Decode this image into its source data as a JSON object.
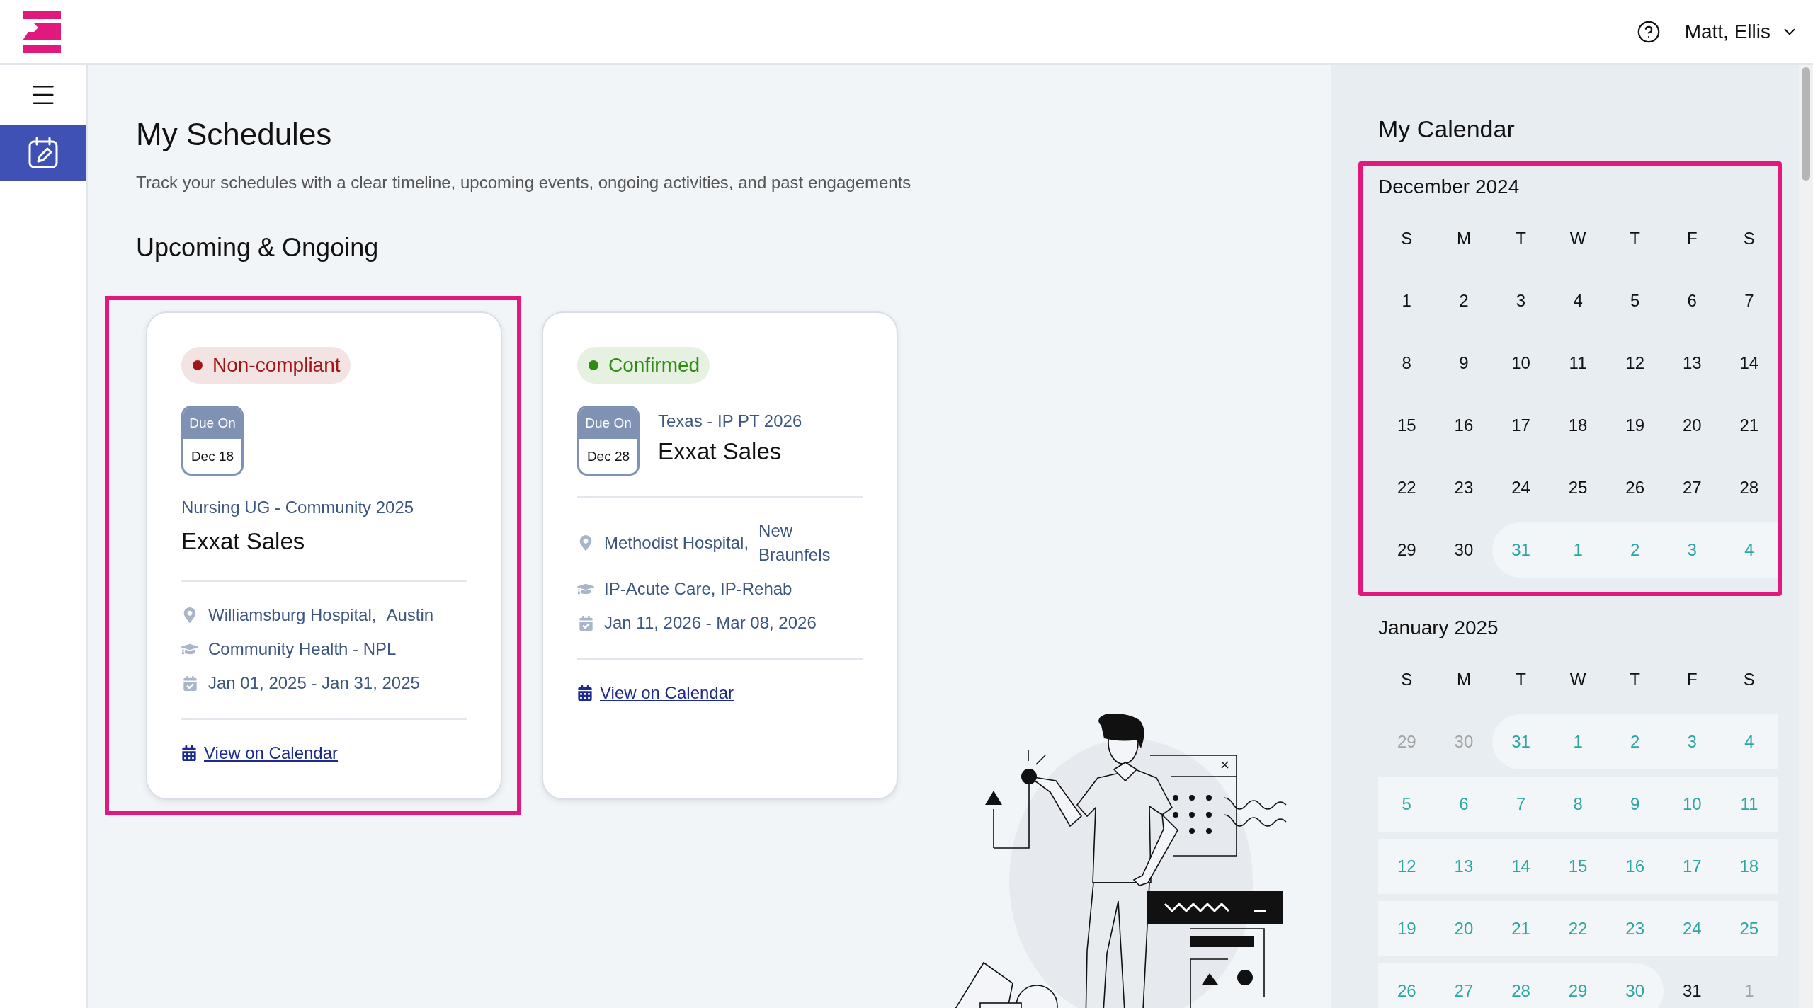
{
  "header": {
    "user_name": "Matt, Ellis"
  },
  "sidebar": {
    "items": [
      {
        "selected": true
      }
    ]
  },
  "page": {
    "title": "My Schedules",
    "subtitle": "Track your schedules with a clear timeline, upcoming events, ongoing activities, and past engagements",
    "section_title": "Upcoming & Ongoing"
  },
  "schedules": [
    {
      "kind": "stacked",
      "highlighted": true,
      "status": {
        "label": "Non-compliant",
        "color": "#a01515"
      },
      "due_label": "Due On",
      "due_date": "Dec 18",
      "program": "Nursing UG - Community 2025",
      "name": "Exxat Sales",
      "hospital": "Williamsburg Hospital,",
      "city": "Austin",
      "specialty": "Community Health - NPL",
      "dates": "Jan 01, 2025 - Jan 31, 2025",
      "link": "View on Calendar"
    },
    {
      "kind": "inline",
      "highlighted": false,
      "status": {
        "label": "Confirmed",
        "color": "#2e8b14"
      },
      "due_label": "Due On",
      "due_date": "Dec 28",
      "program": "Texas - IP PT 2026",
      "name": "Exxat Sales",
      "hospital": "Methodist Hospital,",
      "city": "New Braunfels",
      "specialty": "IP-Acute Care, IP-Rehab",
      "dates": "Jan 11, 2026 - Mar 08, 2026",
      "link": "View on Calendar"
    }
  ],
  "calendar": {
    "title": "My Calendar",
    "months": [
      {
        "title": "December 2024",
        "highlighted": true,
        "weekdays": [
          "S",
          "M",
          "T",
          "W",
          "T",
          "F",
          "S"
        ],
        "weeks": [
          [
            {
              "day": "1",
              "kind": "current"
            },
            {
              "day": "2",
              "kind": "current"
            },
            {
              "day": "3",
              "kind": "current"
            },
            {
              "day": "4",
              "kind": "current"
            },
            {
              "day": "5",
              "kind": "current"
            },
            {
              "day": "6",
              "kind": "current"
            },
            {
              "day": "7",
              "kind": "current"
            }
          ],
          [
            {
              "day": "8",
              "kind": "current"
            },
            {
              "day": "9",
              "kind": "current"
            },
            {
              "day": "10",
              "kind": "current"
            },
            {
              "day": "11",
              "kind": "current"
            },
            {
              "day": "12",
              "kind": "current"
            },
            {
              "day": "13",
              "kind": "current"
            },
            {
              "day": "14",
              "kind": "current"
            }
          ],
          [
            {
              "day": "15",
              "kind": "current"
            },
            {
              "day": "16",
              "kind": "current"
            },
            {
              "day": "17",
              "kind": "current"
            },
            {
              "day": "18",
              "kind": "current"
            },
            {
              "day": "19",
              "kind": "current"
            },
            {
              "day": "20",
              "kind": "current"
            },
            {
              "day": "21",
              "kind": "current"
            }
          ],
          [
            {
              "day": "22",
              "kind": "current"
            },
            {
              "day": "23",
              "kind": "current"
            },
            {
              "day": "24",
              "kind": "current"
            },
            {
              "day": "25",
              "kind": "current"
            },
            {
              "day": "26",
              "kind": "current"
            },
            {
              "day": "27",
              "kind": "current"
            },
            {
              "day": "28",
              "kind": "current"
            }
          ],
          [
            {
              "day": "29",
              "kind": "current"
            },
            {
              "day": "30",
              "kind": "current"
            },
            {
              "day": "31",
              "kind": "scheduled"
            },
            {
              "day": "1",
              "kind": "scheduled"
            },
            {
              "day": "2",
              "kind": "scheduled"
            },
            {
              "day": "3",
              "kind": "scheduled"
            },
            {
              "day": "4",
              "kind": "scheduled"
            }
          ]
        ]
      },
      {
        "title": "January 2025",
        "highlighted": false,
        "weekdays": [
          "S",
          "M",
          "T",
          "W",
          "T",
          "F",
          "S"
        ],
        "weeks": [
          [
            {
              "day": "29",
              "kind": "outside"
            },
            {
              "day": "30",
              "kind": "outside"
            },
            {
              "day": "31",
              "kind": "scheduled"
            },
            {
              "day": "1",
              "kind": "scheduled"
            },
            {
              "day": "2",
              "kind": "scheduled"
            },
            {
              "day": "3",
              "kind": "scheduled"
            },
            {
              "day": "4",
              "kind": "scheduled"
            }
          ],
          [
            {
              "day": "5",
              "kind": "scheduled"
            },
            {
              "day": "6",
              "kind": "scheduled"
            },
            {
              "day": "7",
              "kind": "scheduled"
            },
            {
              "day": "8",
              "kind": "scheduled"
            },
            {
              "day": "9",
              "kind": "scheduled"
            },
            {
              "day": "10",
              "kind": "scheduled"
            },
            {
              "day": "11",
              "kind": "scheduled"
            }
          ],
          [
            {
              "day": "12",
              "kind": "scheduled"
            },
            {
              "day": "13",
              "kind": "scheduled"
            },
            {
              "day": "14",
              "kind": "scheduled"
            },
            {
              "day": "15",
              "kind": "scheduled"
            },
            {
              "day": "16",
              "kind": "scheduled"
            },
            {
              "day": "17",
              "kind": "scheduled"
            },
            {
              "day": "18",
              "kind": "scheduled"
            }
          ],
          [
            {
              "day": "19",
              "kind": "scheduled"
            },
            {
              "day": "20",
              "kind": "scheduled"
            },
            {
              "day": "21",
              "kind": "scheduled"
            },
            {
              "day": "22",
              "kind": "scheduled"
            },
            {
              "day": "23",
              "kind": "scheduled"
            },
            {
              "day": "24",
              "kind": "scheduled"
            },
            {
              "day": "25",
              "kind": "scheduled"
            }
          ],
          [
            {
              "day": "26",
              "kind": "scheduled"
            },
            {
              "day": "27",
              "kind": "scheduled"
            },
            {
              "day": "28",
              "kind": "scheduled"
            },
            {
              "day": "29",
              "kind": "scheduled"
            },
            {
              "day": "30",
              "kind": "scheduled"
            },
            {
              "day": "31",
              "kind": "current"
            },
            {
              "day": "1",
              "kind": "outside"
            }
          ]
        ]
      }
    ]
  }
}
